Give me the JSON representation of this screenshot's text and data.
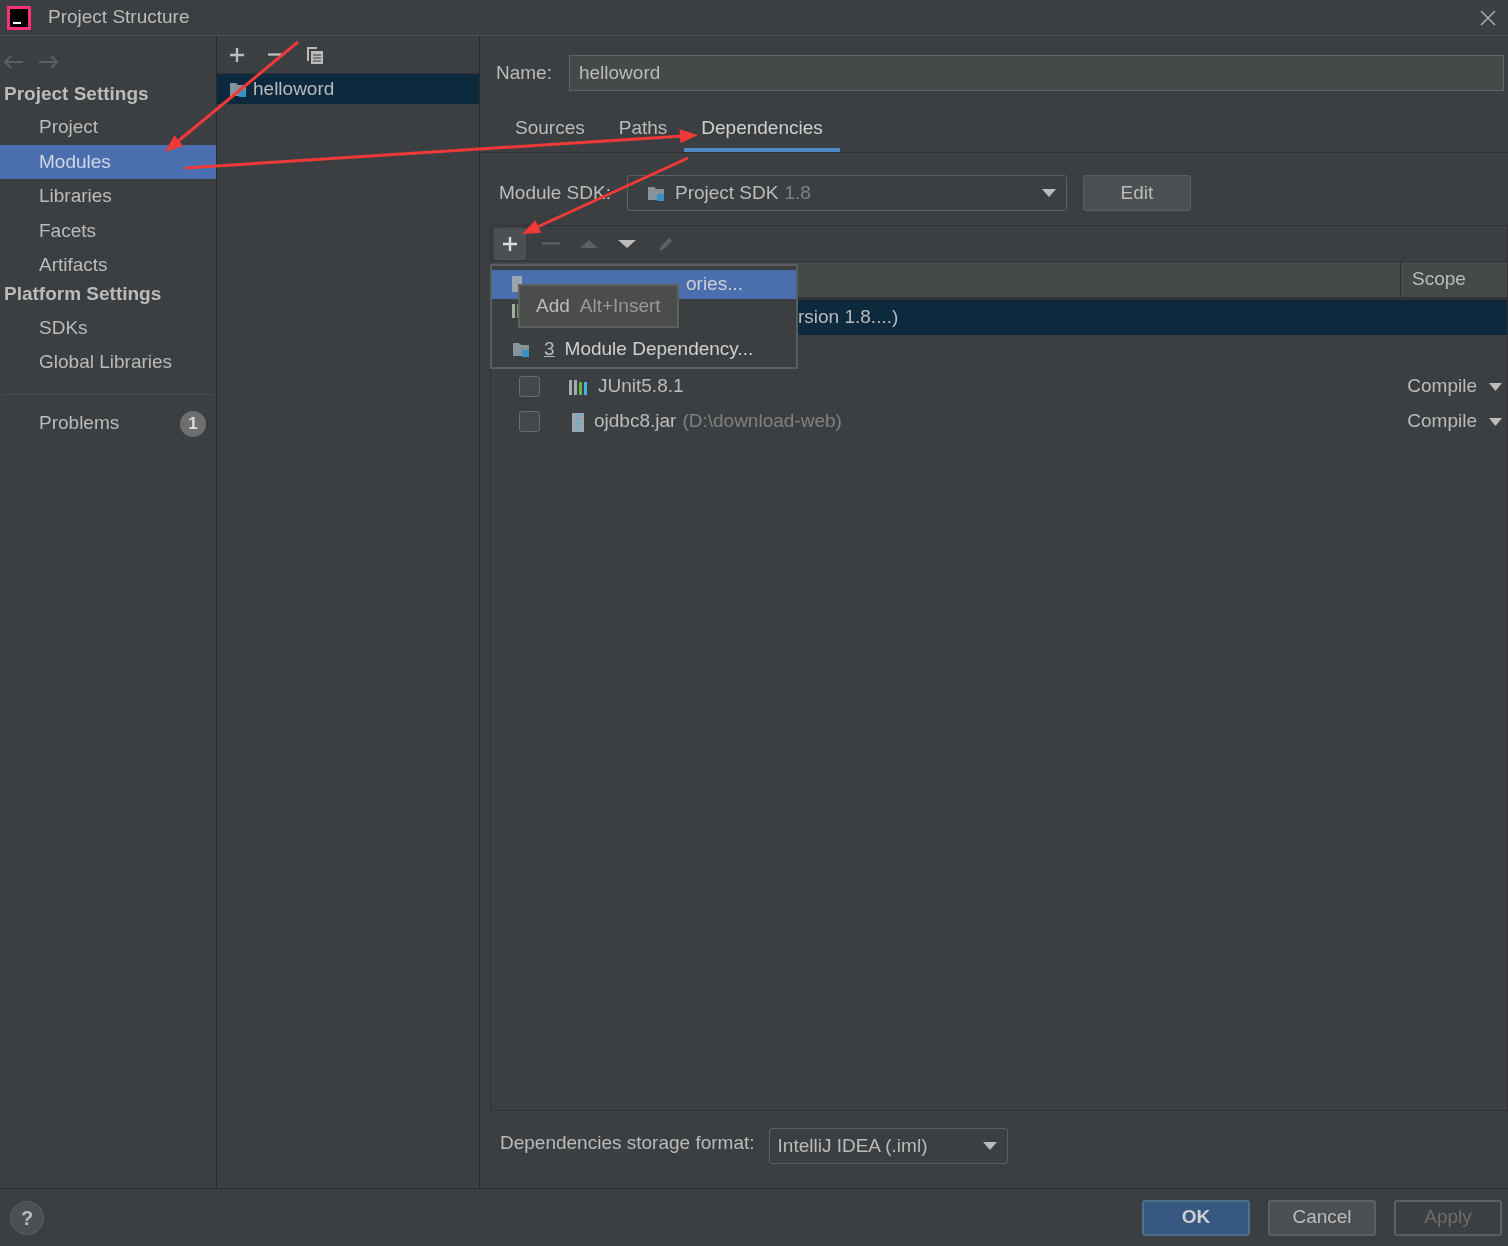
{
  "window": {
    "title": "Project Structure"
  },
  "sidebar": {
    "sections": [
      {
        "title": "Project Settings",
        "items": [
          {
            "label": "Project",
            "selected": false
          },
          {
            "label": "Modules",
            "selected": true
          },
          {
            "label": "Libraries",
            "selected": false
          },
          {
            "label": "Facets",
            "selected": false
          },
          {
            "label": "Artifacts",
            "selected": false
          }
        ]
      },
      {
        "title": "Platform Settings",
        "items": [
          {
            "label": "SDKs",
            "selected": false
          },
          {
            "label": "Global Libraries",
            "selected": false
          }
        ]
      }
    ],
    "problems": {
      "label": "Problems",
      "count": "1"
    }
  },
  "modules": [
    {
      "name": "helloword",
      "selected": true
    }
  ],
  "name_field": {
    "label": "Name:",
    "value": "helloword"
  },
  "tabs": [
    {
      "label": "Sources",
      "selected": false
    },
    {
      "label": "Paths",
      "selected": false
    },
    {
      "label": "Dependencies",
      "selected": true
    }
  ],
  "module_sdk": {
    "label": "Module SDK:",
    "value": "Project SDK",
    "version": "1.8",
    "edit_button": "Edit"
  },
  "table": {
    "columns": [
      "Scope"
    ],
    "rows": [
      {
        "kind": "sdk",
        "text": "rsion 1.8....)",
        "selected": true
      },
      {
        "kind": "library",
        "checked": false,
        "name": "JUnit5.8.1",
        "scope": "Compile",
        "selected": false
      },
      {
        "kind": "jar",
        "checked": false,
        "name": "ojdbc8.jar",
        "detail": "(D:\\download-web)",
        "scope": "Compile",
        "selected": false
      }
    ]
  },
  "add_menu": {
    "items": [
      {
        "kind": "jar",
        "label": "ories...",
        "selected": true
      },
      {
        "kind": "library",
        "selected": false
      },
      {
        "kind": "module",
        "number": "3",
        "label": "Module Dependency...",
        "selected": false
      }
    ]
  },
  "tooltip": {
    "text": "Add",
    "shortcut": "Alt+Insert"
  },
  "storage_format": {
    "label": "Dependencies storage format:",
    "value": "IntelliJ IDEA (.iml)"
  },
  "help": "?",
  "buttons": [
    {
      "label": "OK",
      "kind": "default"
    },
    {
      "label": "Cancel",
      "kind": "normal"
    },
    {
      "label": "Apply",
      "kind": "disabled"
    }
  ]
}
